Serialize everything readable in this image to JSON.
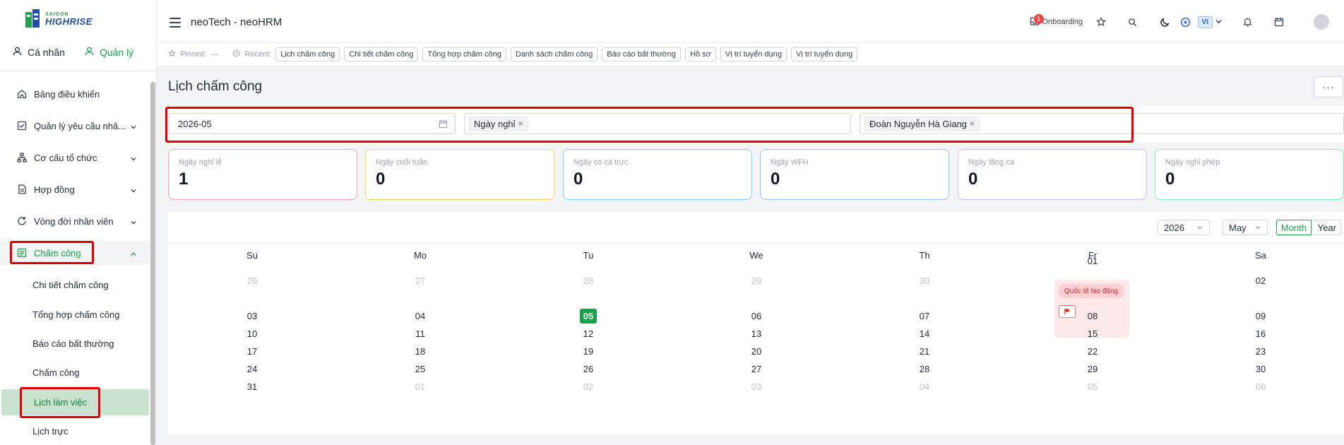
{
  "brand": {
    "line1": "SAIGON",
    "line2": "HIGHRISE"
  },
  "sidebar": {
    "tabs": [
      {
        "label": "Cá nhân"
      },
      {
        "label": "Quản lý"
      }
    ],
    "items": [
      {
        "label": "Bảng điều khiển"
      },
      {
        "label": "Quản lý yêu cầu nhâ..."
      },
      {
        "label": "Cơ cấu tổ chức"
      },
      {
        "label": "Hợp đồng"
      },
      {
        "label": "Vòng đời nhân viên"
      },
      {
        "label": "Chấm công"
      }
    ],
    "subitems": [
      {
        "label": "Chi tiết chấm công"
      },
      {
        "label": "Tổng hợp chấm công"
      },
      {
        "label": "Báo cáo bất thường"
      },
      {
        "label": "Chấm công"
      },
      {
        "label": "Lịch làm việc"
      },
      {
        "label": "Lịch trực"
      }
    ]
  },
  "header": {
    "title": "neoTech - neoHRM",
    "notification_count": "1",
    "onboarding_label": "Onboarding",
    "lang": "VI"
  },
  "recent": {
    "pinned_label": "Pinned:",
    "pinned_value": "—",
    "recent_label": "Recent:",
    "items": [
      "Lịch chấm công",
      "Chi tiết chấm công",
      "Tổng hợp chấm công",
      "Danh sách chấm công",
      "Báo cáo bất thường",
      "Hồ sơ",
      "Vị trí tuyển dụng",
      "Vị trí tuyển dụng"
    ]
  },
  "page": {
    "title": "Lịch chấm công",
    "more_label": "···"
  },
  "filters": {
    "month": "2026-05",
    "type_tag": "Ngày nghỉ",
    "employee_tag": "Đoàn Nguyễn Hà Giang"
  },
  "stats": [
    {
      "label": "Ngày nghỉ lễ",
      "value": "1",
      "color": "#fca5a5"
    },
    {
      "label": "Ngày cuối tuần",
      "value": "0",
      "color": "#fcd34d"
    },
    {
      "label": "Ngày có ca trực",
      "value": "0",
      "color": "#7dd3fc"
    },
    {
      "label": "Ngày WFH",
      "value": "0",
      "color": "#93c5fd"
    },
    {
      "label": "Ngày tăng ca",
      "value": "0",
      "color": "#d8b4fe"
    },
    {
      "label": "Ngày nghỉ phép",
      "value": "0",
      "color": "#86efac"
    }
  ],
  "calendar": {
    "year": "2026",
    "month": "May",
    "view_month": "Month",
    "view_year": "Year",
    "weekdays": [
      "Su",
      "Mo",
      "Tu",
      "We",
      "Th",
      "Fr",
      "Sa"
    ],
    "weeks": [
      [
        {
          "d": "26",
          "m": true
        },
        {
          "d": "27",
          "m": true
        },
        {
          "d": "28",
          "m": true
        },
        {
          "d": "29",
          "m": true
        },
        {
          "d": "30",
          "m": true
        },
        {
          "d": "01",
          "m": false
        },
        {
          "d": "02",
          "m": false
        }
      ],
      [
        {
          "d": "03",
          "m": false
        },
        {
          "d": "04",
          "m": false
        },
        {
          "d": "05",
          "m": false,
          "today": true
        },
        {
          "d": "06",
          "m": false
        },
        {
          "d": "07",
          "m": false
        },
        {
          "d": "08",
          "m": false
        },
        {
          "d": "09",
          "m": false
        }
      ],
      [
        {
          "d": "10",
          "m": false
        },
        {
          "d": "11",
          "m": false
        },
        {
          "d": "12",
          "m": false
        },
        {
          "d": "13",
          "m": false
        },
        {
          "d": "14",
          "m": false
        },
        {
          "d": "15",
          "m": false
        },
        {
          "d": "16",
          "m": false
        }
      ],
      [
        {
          "d": "17",
          "m": false
        },
        {
          "d": "18",
          "m": false
        },
        {
          "d": "19",
          "m": false
        },
        {
          "d": "20",
          "m": false
        },
        {
          "d": "21",
          "m": false
        },
        {
          "d": "22",
          "m": false
        },
        {
          "d": "23",
          "m": false
        }
      ],
      [
        {
          "d": "24",
          "m": false
        },
        {
          "d": "25",
          "m": false
        },
        {
          "d": "26",
          "m": false
        },
        {
          "d": "27",
          "m": false
        },
        {
          "d": "28",
          "m": false
        },
        {
          "d": "29",
          "m": false
        },
        {
          "d": "30",
          "m": false
        }
      ],
      [
        {
          "d": "31",
          "m": false
        },
        {
          "d": "01",
          "m": true
        },
        {
          "d": "02",
          "m": true
        },
        {
          "d": "03",
          "m": true
        },
        {
          "d": "04",
          "m": true
        },
        {
          "d": "05",
          "m": true
        },
        {
          "d": "06",
          "m": true
        }
      ]
    ],
    "holiday_label": "Quốc tế lao động"
  }
}
